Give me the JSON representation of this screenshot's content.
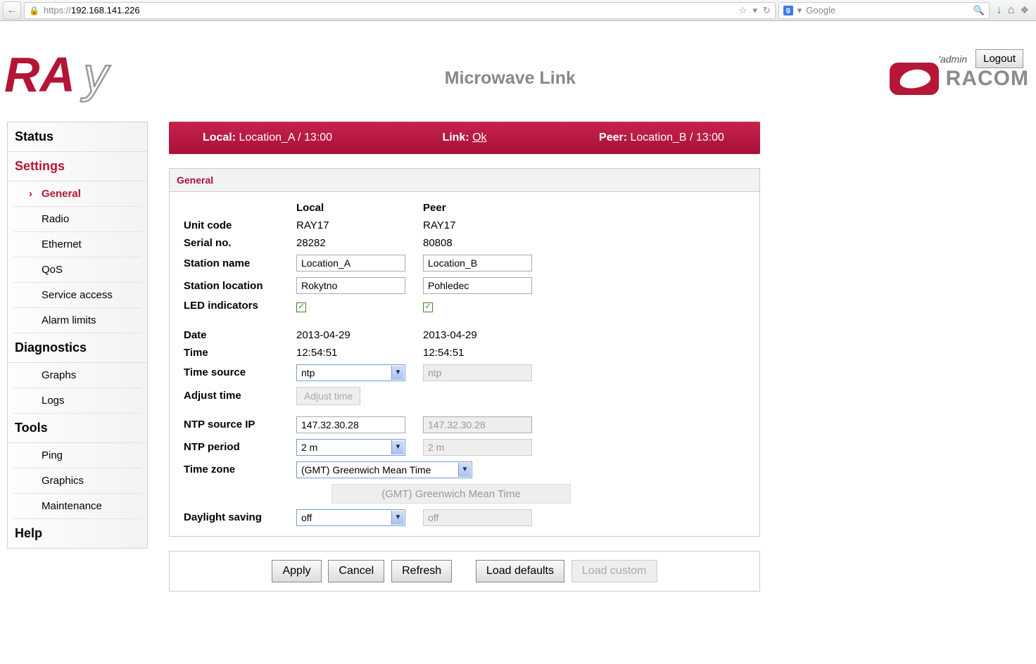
{
  "browser": {
    "url_prefix": "https://",
    "url_host": "192.168.141.226",
    "search_placeholder": "Google"
  },
  "header": {
    "user": "'admin",
    "logout": "Logout",
    "title": "Microwave Link",
    "brand": "RACOM"
  },
  "statusbar": {
    "local_label": "Local:",
    "local_val": " Location_A / 13:00",
    "link_label": "Link:",
    "link_val": "Ok",
    "peer_label": "Peer:",
    "peer_val": " Location_B / 13:00"
  },
  "sidebar": {
    "status": "Status",
    "settings": "Settings",
    "settings_items": {
      "general": "General",
      "radio": "Radio",
      "ethernet": "Ethernet",
      "qos": "QoS",
      "service": "Service access",
      "alarm": "Alarm limits"
    },
    "diagnostics": "Diagnostics",
    "diag_items": {
      "graphs": "Graphs",
      "logs": "Logs"
    },
    "tools": "Tools",
    "tools_items": {
      "ping": "Ping",
      "graphics": "Graphics",
      "maint": "Maintenance"
    },
    "help": "Help"
  },
  "panel": {
    "title": "General",
    "col_local": "Local",
    "col_peer": "Peer",
    "rows": {
      "unit_code": "Unit code",
      "unit_code_l": "RAY17",
      "unit_code_p": "RAY17",
      "serial": "Serial no.",
      "serial_l": "28282",
      "serial_p": "80808",
      "station_name": "Station name",
      "station_name_l": "Location_A",
      "station_name_p": "Location_B",
      "station_loc": "Station location",
      "station_loc_l": "Rokytno",
      "station_loc_p": "Pohledec",
      "led": "LED indicators",
      "date": "Date",
      "date_l": "2013-04-29",
      "date_p": "2013-04-29",
      "time": "Time",
      "time_l": "12:54:51",
      "time_p": "12:54:51",
      "time_src": "Time source",
      "time_src_l": "ntp",
      "time_src_p": "ntp",
      "adjust": "Adjust time",
      "adjust_btn": "Adjust time",
      "ntp_ip": "NTP source IP",
      "ntp_ip_l": "147.32.30.28",
      "ntp_ip_p": "147.32.30.28",
      "ntp_period": "NTP period",
      "ntp_period_l": "2 m",
      "ntp_period_p": "2 m",
      "tz": "Time zone",
      "tz_l": "(GMT) Greenwich Mean Time",
      "tz_p": "(GMT) Greenwich Mean Time",
      "dst": "Daylight saving",
      "dst_l": "off",
      "dst_p": "off"
    }
  },
  "buttons": {
    "apply": "Apply",
    "cancel": "Cancel",
    "refresh": "Refresh",
    "defaults": "Load defaults",
    "custom": "Load custom"
  }
}
